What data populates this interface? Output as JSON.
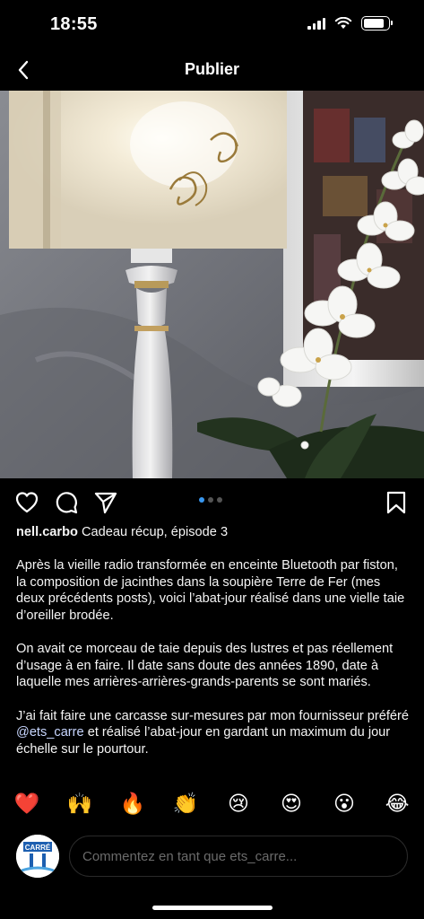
{
  "status_bar": {
    "time": "18:55"
  },
  "nav": {
    "title": "Publier"
  },
  "carousel": {
    "pages": 3,
    "active_page": 1
  },
  "post": {
    "username": "nell.carbo",
    "caption_title": "Cadeau récup, épisode 3",
    "paragraph_1": "Après la vieille radio transformée en enceinte Bluetooth par fiston, la composition de jacinthes dans la soupière Terre de Fer (mes deux précédents posts), voici l’abat-jour réalisé dans une vielle taie d’oreiller brodée.",
    "paragraph_2": "On avait ce morceau de taie depuis des lustres et pas réellement d’usage à en faire. Il date sans doute des années 1890, date à laquelle mes arrières-arrières-grands-parents se sont mariés.",
    "paragraph_3_before": "J’ai fait faire une carcasse sur-mesures par mon fournisseur préféré ",
    "paragraph_3_mention": "@ets_carre",
    "paragraph_3_after": " et réalisé l’abat-jour en gardant un maximum du jour échelle sur le pourtour."
  },
  "emojis": [
    "❤️",
    "🙌",
    "🔥",
    "👏",
    "😢",
    "😍",
    "😮",
    "😂"
  ],
  "comment": {
    "placeholder": "Commentez en tant que ets_carre...",
    "avatar_text": "CARRÉ"
  },
  "colors": {
    "accent": "#3897f0",
    "background": "#000000"
  }
}
